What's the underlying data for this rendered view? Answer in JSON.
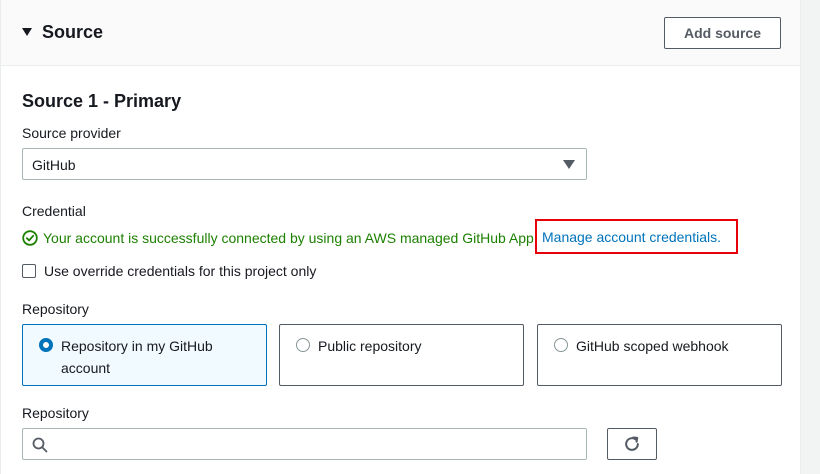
{
  "section": {
    "title": "Source",
    "add_button": "Add source"
  },
  "source": {
    "heading": "Source 1 - Primary",
    "provider_label": "Source provider",
    "provider_value": "GitHub",
    "credential_label": "Credential",
    "credential_status": "Your account is successfully connected by using an AWS managed GitHub App.",
    "manage_link": "Manage account credentials.",
    "override_label": "Use override credentials for this project only",
    "override_checked": false,
    "repository_label": "Repository",
    "repository_options": [
      {
        "label": "Repository in my GitHub account",
        "selected": true
      },
      {
        "label": "Public repository",
        "selected": false
      },
      {
        "label": "GitHub scoped webhook",
        "selected": false
      }
    ],
    "repository_search_label": "Repository",
    "repository_search_value": "",
    "repository_search_placeholder": ""
  },
  "colors": {
    "success": "#1d8102",
    "link": "#0073bb",
    "highlight_box": "#e8000b",
    "selected_tile_bg": "#f1faff"
  }
}
